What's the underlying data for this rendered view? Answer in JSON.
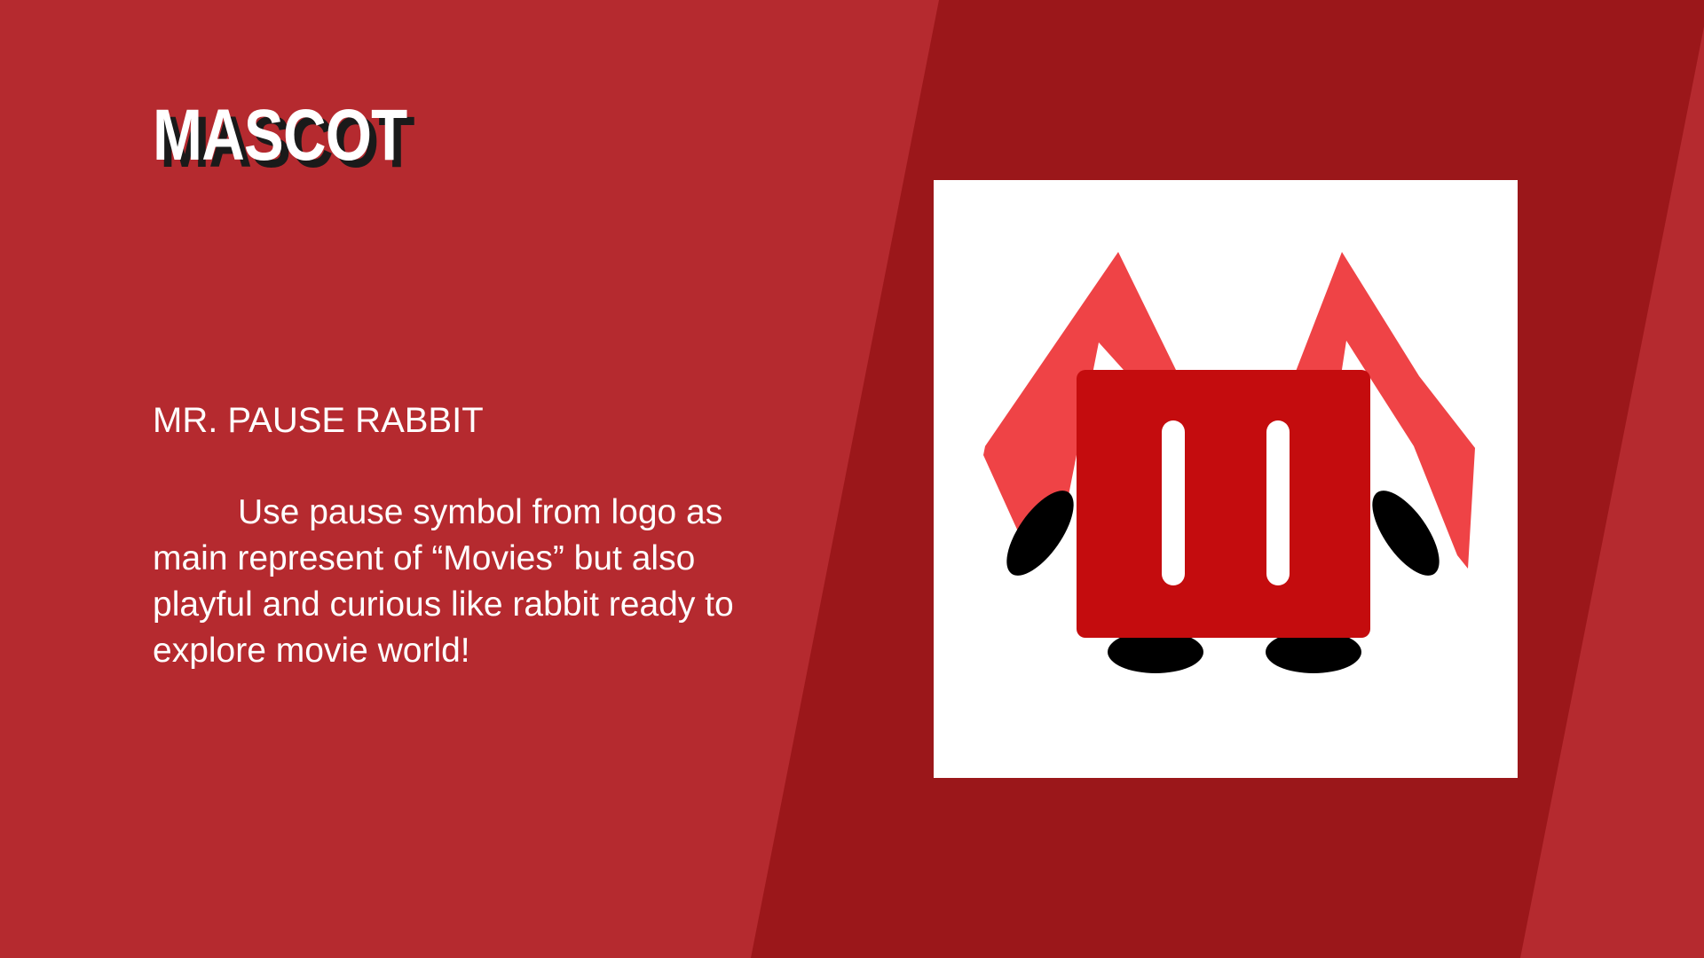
{
  "slide": {
    "title": "MASCOT",
    "subtitle": "MR. PAUSE RABBIT",
    "description": "Use pause symbol from logo as main represent of “Movies” but also playful and curious like rabbit ready to explore movie world!"
  },
  "colors": {
    "background": "#b52a2f",
    "band": "#9b171a",
    "title_shadow": "#1a1a1a",
    "mascot_body": "#c40c0e",
    "mascot_ears": "#ef4346",
    "mascot_limbs": "#000000",
    "card": "#ffffff"
  },
  "mascot": {
    "name": "pause-rabbit",
    "icon": "pause-icon"
  }
}
